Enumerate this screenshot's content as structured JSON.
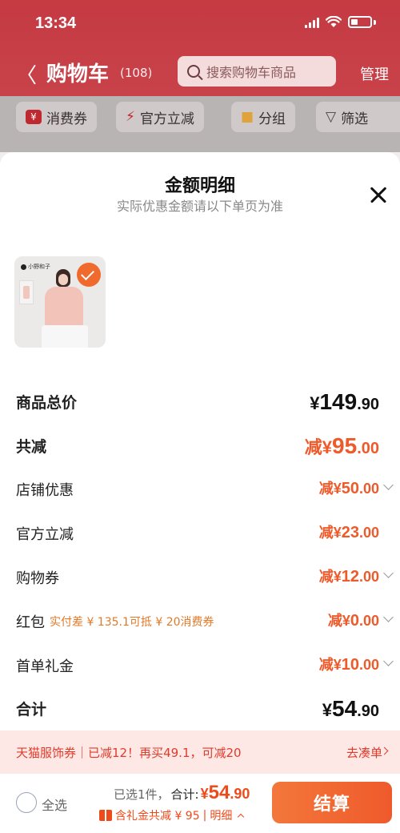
{
  "status_bar": {
    "time": "13:34"
  },
  "nav": {
    "back_glyph": "〈",
    "title": "购物车",
    "count": "(108)",
    "search_placeholder": "搜索购物车商品",
    "manage": "管理"
  },
  "filters": [
    {
      "icon": "coupon-icon",
      "label": "消费券"
    },
    {
      "icon": "lightning-icon",
      "label": "官方立减"
    },
    {
      "icon": "folder-icon",
      "label": "分组"
    },
    {
      "icon": "filter-icon",
      "label": "筛选"
    }
  ],
  "sheet": {
    "title": "金额明细",
    "subtitle": "实际优惠金额请以下单页为准",
    "product": {
      "brand": "小野和子",
      "selected": true
    },
    "rows": [
      {
        "label": "商品总价",
        "yen": "¥",
        "int": "149",
        "dec": ".90",
        "prefix": ""
      },
      {
        "label": "共减",
        "prefix": "减",
        "yen": "¥",
        "int": "95",
        "dec": ".00"
      },
      {
        "label": "店铺优惠",
        "prefix": "减",
        "yen": "¥",
        "int": "50",
        "dec": ".00"
      },
      {
        "label": "官方立减",
        "prefix": "减",
        "yen": "¥",
        "int": "23",
        "dec": ".00"
      },
      {
        "label": "购物券",
        "prefix": "减",
        "yen": "¥",
        "int": "12",
        "dec": ".00"
      },
      {
        "label": "红包",
        "note": "实付差 ¥ 135.1可抵 ¥ 20消费券",
        "prefix": "减",
        "yen": "¥",
        "int": "0",
        "dec": ".00"
      },
      {
        "label": "首单礼金",
        "prefix": "减",
        "yen": "¥",
        "int": "10",
        "dec": ".00"
      },
      {
        "label": "合计",
        "yen": "¥",
        "int": "54",
        "dec": ".90",
        "prefix": ""
      }
    ],
    "promo": {
      "text": "天猫服饰券｜已减12！再买49.1，可减20",
      "link": "去凑单"
    }
  },
  "bottom": {
    "select_all": "全选",
    "selected_text": "已选1件，",
    "total_label": "合计:",
    "total_yen": "¥",
    "total_int": "54",
    "total_dec": ".90",
    "gift_text": "含礼金共减 ¥ 95",
    "detail_link": "明细",
    "checkout": "结算"
  },
  "colors": {
    "accent": "#ee5a2a",
    "header": "#c63a42",
    "promo_bg": "#fde8e6"
  }
}
